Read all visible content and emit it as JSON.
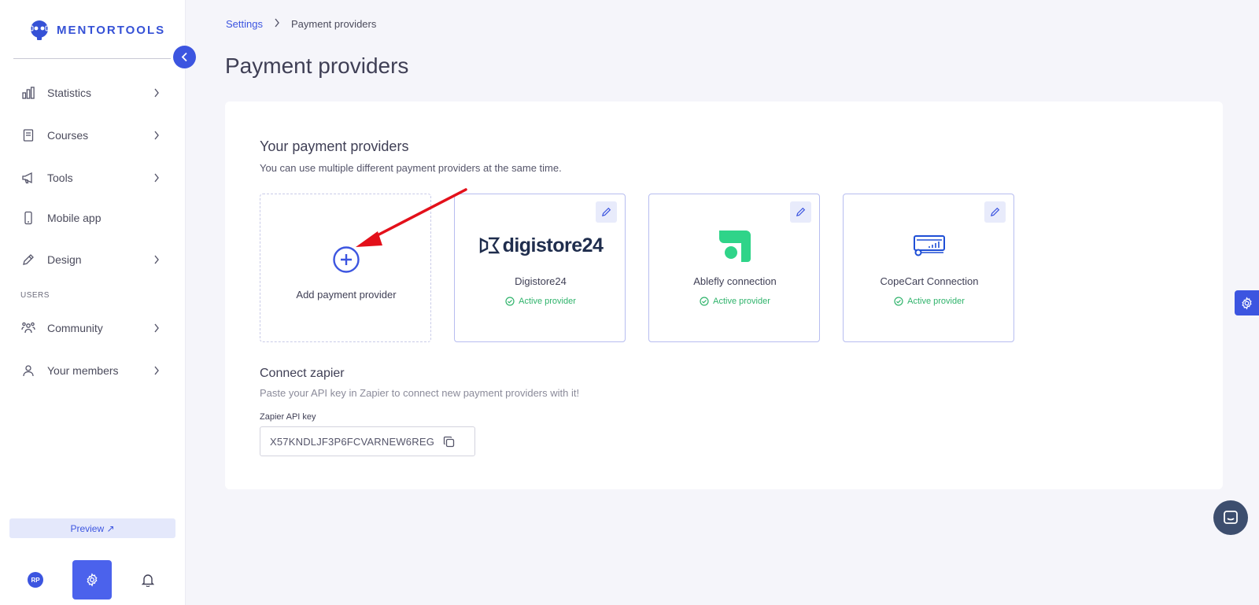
{
  "brand": {
    "name": "MENTORTOOLS",
    "accent": "#3c55e0"
  },
  "sidebar": {
    "items": [
      {
        "label": "Statistics",
        "icon": "bar-chart-icon",
        "has_children": true
      },
      {
        "label": "Courses",
        "icon": "book-icon",
        "has_children": true
      },
      {
        "label": "Tools",
        "icon": "megaphone-icon",
        "has_children": true
      },
      {
        "label": "Mobile app",
        "icon": "smartphone-icon",
        "has_children": false
      },
      {
        "label": "Design",
        "icon": "edit-icon",
        "has_children": true
      },
      {
        "label": "Community",
        "icon": "group-icon",
        "has_children": true
      },
      {
        "label": "Your members",
        "icon": "user-icon",
        "has_children": true
      }
    ],
    "section_users": "USERS",
    "preview_label": "Preview ↗",
    "avatar_initials": "RP"
  },
  "breadcrumb": {
    "parent": "Settings",
    "separator": ">",
    "current": "Payment providers"
  },
  "page": {
    "title": "Payment providers"
  },
  "providers_section": {
    "title": "Your payment providers",
    "subtitle": "You can use multiple different payment providers at the same time.",
    "add_label": "Add payment provider",
    "providers": [
      {
        "name": "Digistore24",
        "logo_text": "digistore24",
        "status": "Active provider"
      },
      {
        "name": "Ablefly connection",
        "logo_text": "",
        "status": "Active provider"
      },
      {
        "name": "CopeCart Connection",
        "logo_text": "",
        "status": "Active provider"
      }
    ]
  },
  "zapier": {
    "title": "Connect zapier",
    "subtitle": "Paste your API key in Zapier to connect new payment providers with it!",
    "field_label": "Zapier API key",
    "api_key": "X57KNDLJF3P6FCVARNEW6REG"
  },
  "colors": {
    "status_green": "#2fb36b",
    "annotation_red": "#e3101a"
  }
}
